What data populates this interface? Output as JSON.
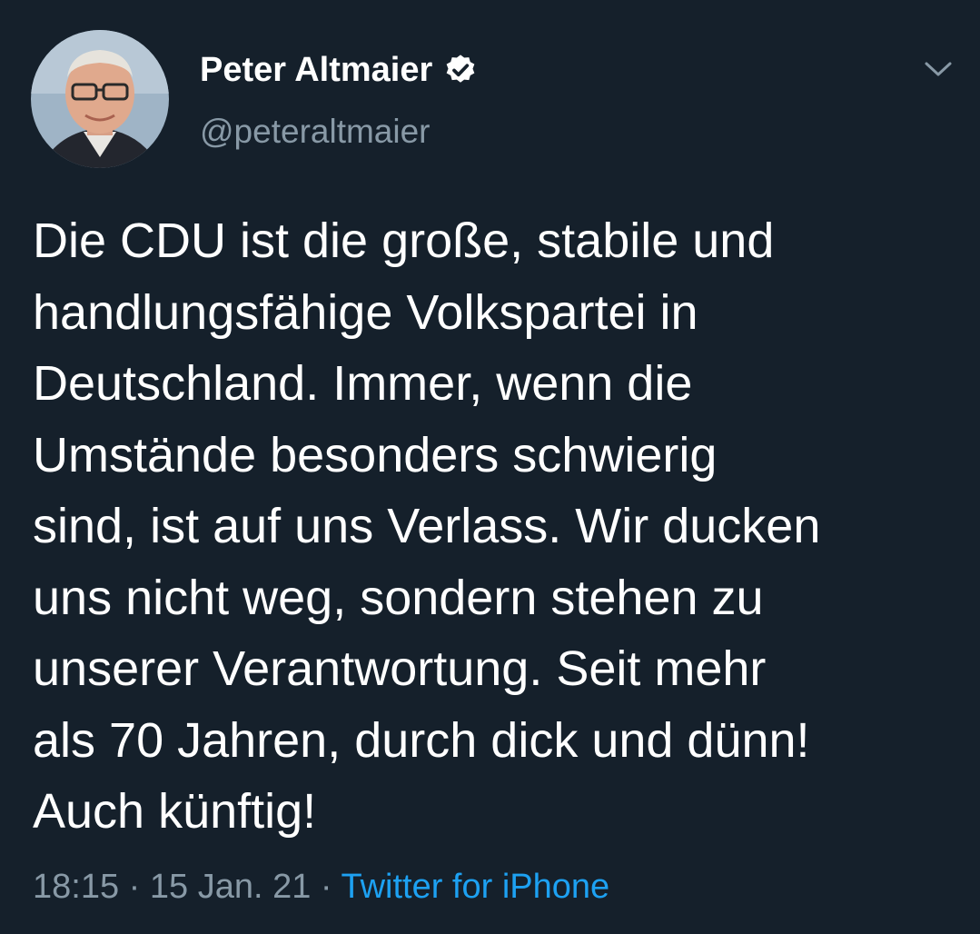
{
  "author": {
    "display_name": "Peter Altmaier",
    "handle": "@peteraltmaier",
    "verified_icon": "verified-badge-icon",
    "avatar_icon": "avatar-photo"
  },
  "actions": {
    "more_icon": "chevron-down-icon"
  },
  "tweet": {
    "text_lines": [
      "Die CDU ist die große, stabile und",
      "handlungsfähige Volkspartei in",
      "Deutschland. Immer, wenn die",
      "Umstände besonders schwierig",
      "sind, ist auf uns Verlass. Wir ducken",
      "uns nicht weg, sondern stehen zu",
      "unserer Verantwortung. Seit mehr",
      "als 70 Jahren, durch dick und dünn!",
      "Auch künftig!"
    ],
    "time": "18:15",
    "separator": "·",
    "date": "15 Jan. 21",
    "source": "Twitter for iPhone"
  },
  "colors": {
    "background": "#15202b",
    "text": "#ffffff",
    "secondary_text": "#8899a6",
    "link": "#1da1f2"
  }
}
